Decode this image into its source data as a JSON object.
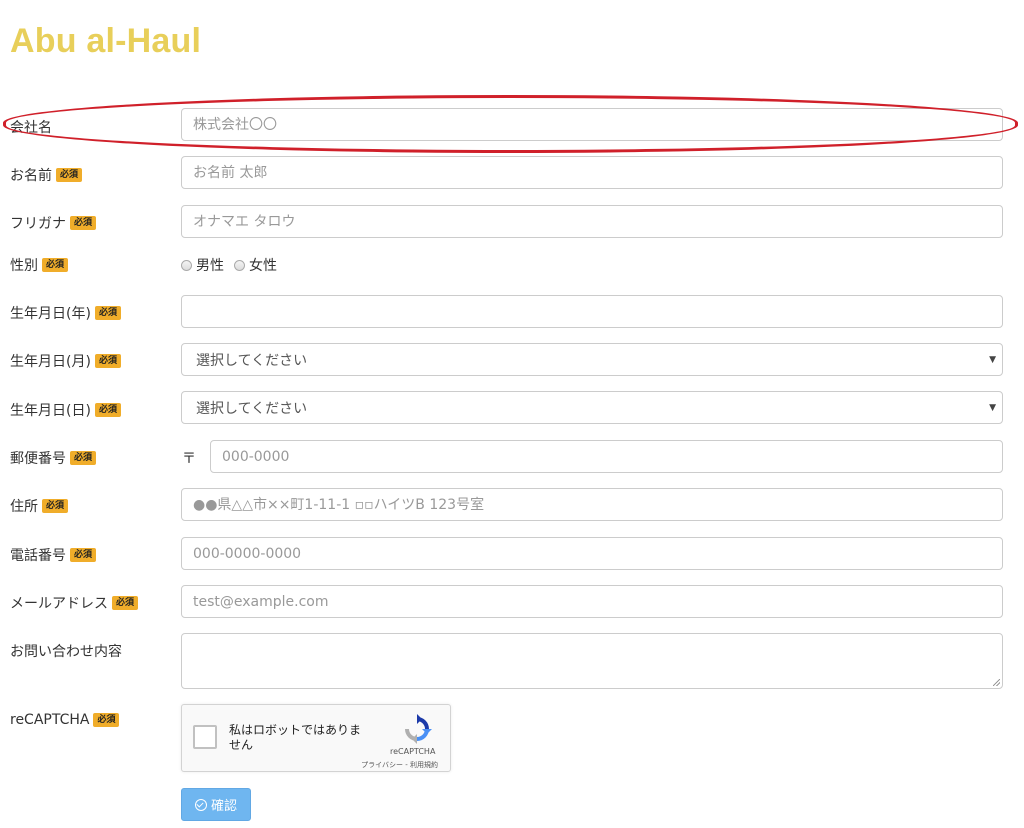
{
  "site": {
    "title": "Abu al-Haul"
  },
  "required_badge": "必須",
  "form": {
    "company": {
      "label": "会社名",
      "placeholder": "株式会社〇〇"
    },
    "name": {
      "label": "お名前",
      "placeholder": "お名前 太郎"
    },
    "furigana": {
      "label": "フリガナ",
      "placeholder": "オナマエ タロウ"
    },
    "gender": {
      "label": "性別",
      "options": [
        "男性",
        "女性"
      ]
    },
    "birth_year": {
      "label": "生年月日(年)",
      "placeholder": ""
    },
    "birth_month": {
      "label": "生年月日(月)",
      "selected": "選択してください"
    },
    "birth_day": {
      "label": "生年月日(日)",
      "selected": "選択してください"
    },
    "postal": {
      "label": "郵便番号",
      "mark": "〒",
      "placeholder": "000-0000"
    },
    "address": {
      "label": "住所",
      "placeholder": "●●県△△市××町1-11-1 ▫▫ハイツB 123号室"
    },
    "phone": {
      "label": "電話番号",
      "placeholder": "000-0000-0000"
    },
    "email": {
      "label": "メールアドレス",
      "placeholder": "test@example.com"
    },
    "inquiry": {
      "label": "お問い合わせ内容"
    },
    "recaptcha": {
      "label": "reCAPTCHA",
      "checkbox_text": "私はロボットではありません",
      "brand": "reCAPTCHA",
      "links": "プライバシー - 利用規約"
    },
    "submit_label": "確認"
  },
  "colors": {
    "title": "#e8cf5a",
    "required_badge": "#f0ad2a",
    "submit": "#6fb6f0",
    "highlight": "#d0202a"
  }
}
